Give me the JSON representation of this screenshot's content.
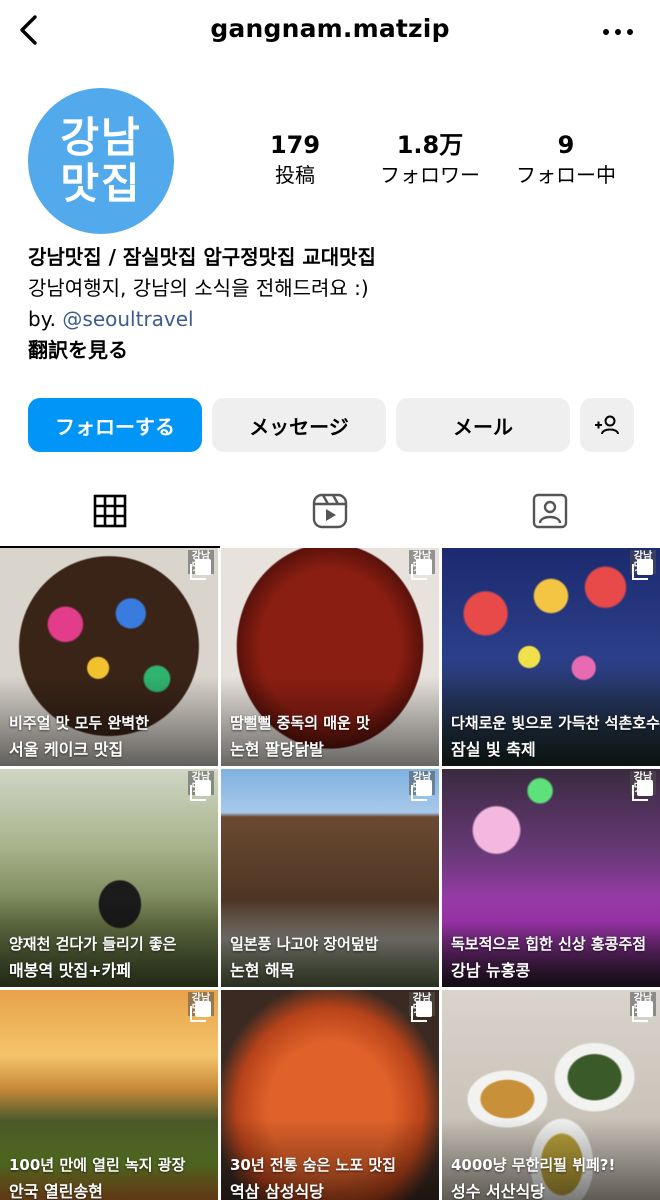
{
  "header": {
    "username": "gangnam.matzip"
  },
  "profile": {
    "avatar_line1": "강남",
    "avatar_line2": "맛집",
    "stats": [
      {
        "value": "179",
        "label": "投稿"
      },
      {
        "value": "1.8万",
        "label": "フォロワー"
      },
      {
        "value": "9",
        "label": "フォロー中"
      }
    ],
    "name": "강남맛집 / 잠실맛집 압구정맛집 교대맛집",
    "bio_line": "강남여행지, 강남의 소식을 전해드려요 :)",
    "by_prefix": "by.",
    "by_link": "@seoultravel",
    "translate": "翻訳を見る"
  },
  "actions": {
    "follow": "フォローする",
    "message": "メッセージ",
    "mail": "メール"
  },
  "colors": {
    "accent": "#0095f6",
    "avatar_bg": "#52a9ec",
    "link": "#3c5b91"
  },
  "posts": [
    {
      "line1": "비주얼 맛 모두 완벽한",
      "line2": "서울 케이크 맛집",
      "brand": "강남맛집"
    },
    {
      "line1": "땀뻘뻘 중독의 매운 맛",
      "line2": "논현 팔당닭발",
      "brand": "강남맛집"
    },
    {
      "line1": "다채로운 빛으로 가득찬 석촌호수",
      "line2": "잠실 빛 축제",
      "brand": "강남맛집"
    },
    {
      "line1": "양재천 걷다가 들리기 좋은",
      "line2": "매봉역 맛집+카페",
      "brand": "강남맛집"
    },
    {
      "line1": "일본풍 나고야 장어덮밥",
      "line2": "논현 해목",
      "brand": "강남맛집"
    },
    {
      "line1": "독보적으로 힙한 신상 홍콩주점",
      "line2": "강남 뉴홍콩",
      "brand": "강남맛집"
    },
    {
      "line1": "100년 만에 열린 녹지 광장",
      "line2": "안국 열린송현",
      "brand": "강남맛집"
    },
    {
      "line1": "30년 전통 숨은 노포 맛집",
      "line2": "역삼 삼성식당",
      "brand": "강남맛집"
    },
    {
      "line1": "4000냥 무한리필 뷔페?!",
      "line2": "성수 서산식당",
      "brand": "강남맛집"
    }
  ]
}
